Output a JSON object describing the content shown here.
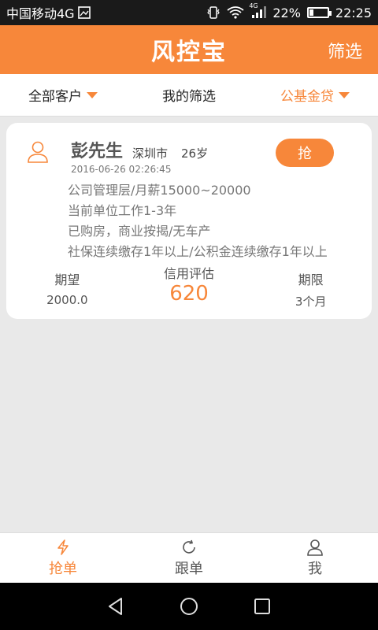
{
  "statusbar": {
    "carrier": "中国移动4G",
    "battery_percent_text": "22%",
    "battery_level": 0.22,
    "time": "22:25",
    "net_label": "4G"
  },
  "header": {
    "title": "风控宝",
    "filter_label": "筛选"
  },
  "filterbar": {
    "tabs": [
      {
        "label": "全部客户"
      },
      {
        "label": "我的筛选"
      },
      {
        "label": "公基金贷"
      }
    ]
  },
  "card": {
    "name": "彭先生",
    "city": "深圳市",
    "age": "26岁",
    "date": "2016-06-26 02:26:45",
    "grab_label": "抢",
    "details": [
      "公司管理层/月薪15000~20000",
      "当前单位工作1-3年",
      "已购房，商业按揭/无车产",
      "社保连续缴存1年以上/公积金连续缴存1年以上"
    ],
    "stats": [
      {
        "label": "期望",
        "value": "2000.0"
      },
      {
        "label": "信用评估",
        "value": "620"
      },
      {
        "label": "期限",
        "value": "3个月"
      }
    ]
  },
  "bottomnav": {
    "items": [
      {
        "label": "抢单",
        "icon": "lightning-icon"
      },
      {
        "label": "跟单",
        "icon": "refresh-icon"
      },
      {
        "label": "我",
        "icon": "person-icon"
      }
    ]
  },
  "colors": {
    "accent": "#f7873a"
  }
}
